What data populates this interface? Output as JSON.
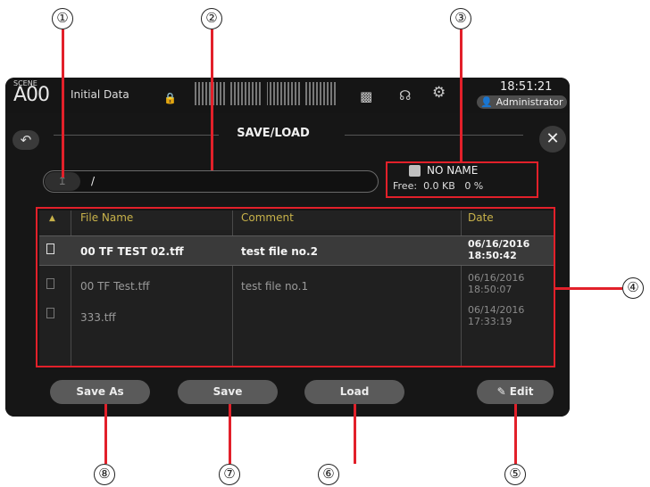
{
  "callouts": [
    "①",
    "②",
    "③",
    "④",
    "⑤",
    "⑥",
    "⑦",
    "⑧"
  ],
  "header": {
    "scene_label": "SCENE",
    "scene_number": "A00",
    "scene_name": "Initial Data",
    "clock": "18:51:21",
    "user": "Administrator"
  },
  "panel": {
    "title": "SAVE/LOAD",
    "back_icon": "back-arrow-icon",
    "close_icon": "close-icon"
  },
  "path": {
    "value": "/"
  },
  "media": {
    "name": "NO NAME",
    "free_label": "Free:",
    "free_size": "0.0 KB",
    "free_percent": "0 %"
  },
  "table": {
    "sort_icon": "▲",
    "headers": [
      "File Name",
      "Comment",
      "Date"
    ],
    "rows": [
      {
        "file": "00 TF TEST 02.tff",
        "comment": "test file no.2",
        "date": "06/16/2016",
        "time": "18:50:42",
        "selected": true
      },
      {
        "file": "00 TF Test.tff",
        "comment": "test file no.1",
        "date": "06/16/2016",
        "time": "18:50:07",
        "selected": false
      },
      {
        "file": "333.tff",
        "comment": "",
        "date": "06/14/2016",
        "time": "17:33:19",
        "selected": false
      }
    ]
  },
  "buttons": {
    "save_as": "Save As",
    "save": "Save",
    "load": "Load",
    "edit": "Edit"
  },
  "colors": {
    "accent": "#e2202a",
    "header_text": "#c8b24a",
    "panel": "#161616"
  }
}
